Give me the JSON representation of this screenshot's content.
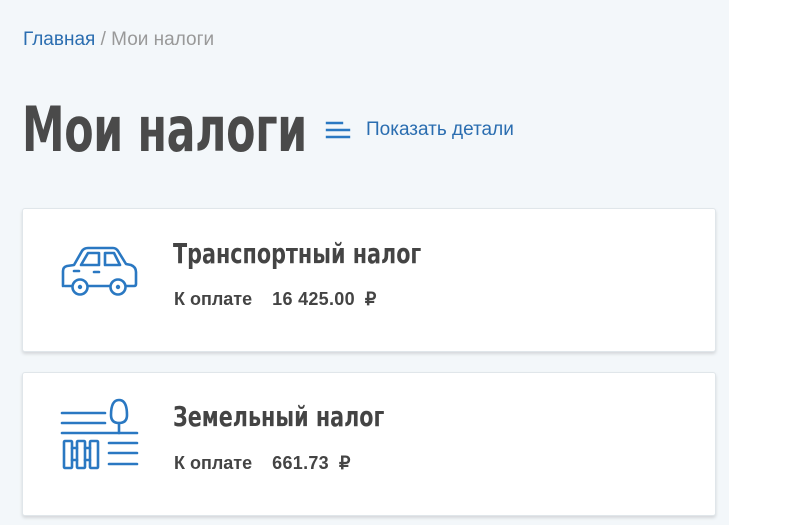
{
  "breadcrumb": {
    "home": "Главная",
    "separator": " / ",
    "current": "Мои налоги"
  },
  "header": {
    "title": "Мои налоги",
    "details_toggle": {
      "label": "Показать детали",
      "icon": "menu-lines-icon"
    }
  },
  "taxes": [
    {
      "icon": "car-icon",
      "title": "Транспортный налог",
      "pay_label": "К оплате",
      "amount": "16 425.00",
      "currency": "₽"
    },
    {
      "icon": "land-fence-tree-icon",
      "title": "Земельный налог",
      "pay_label": "К оплате",
      "amount": "661.73",
      "currency": "₽"
    }
  ],
  "colors": {
    "background": "#f3f7fa",
    "link": "#2a6db0",
    "icon": "#2a78c2",
    "text_dark": "#444444",
    "muted": "#999999"
  }
}
